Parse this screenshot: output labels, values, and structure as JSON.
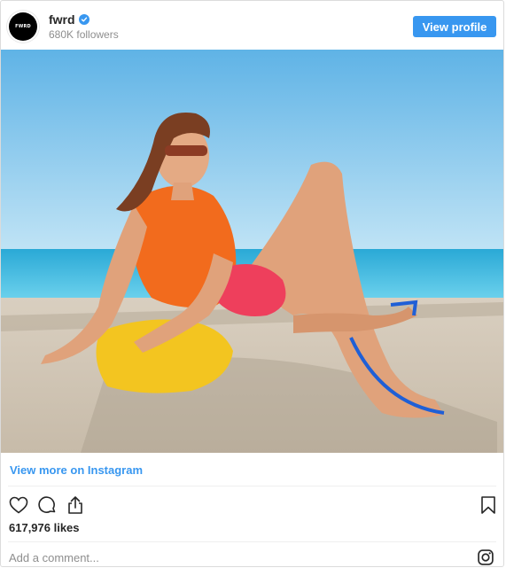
{
  "post": {
    "username": "fwrd",
    "avatar_text": "FWRD",
    "verified": true,
    "followers": "680K followers",
    "view_profile_label": "View profile",
    "view_more_label": "View more on Instagram",
    "likes": "617,976 likes",
    "comment_placeholder": "Add a comment..."
  },
  "icons": {
    "verified": "verified-badge-icon",
    "like": "heart-icon",
    "comment": "comment-bubble-icon",
    "share": "share-icon",
    "save": "bookmark-icon",
    "instagram": "instagram-logo-icon"
  },
  "colors": {
    "accent": "#3897f0",
    "text": "#262626",
    "muted": "#8e8e8e"
  }
}
